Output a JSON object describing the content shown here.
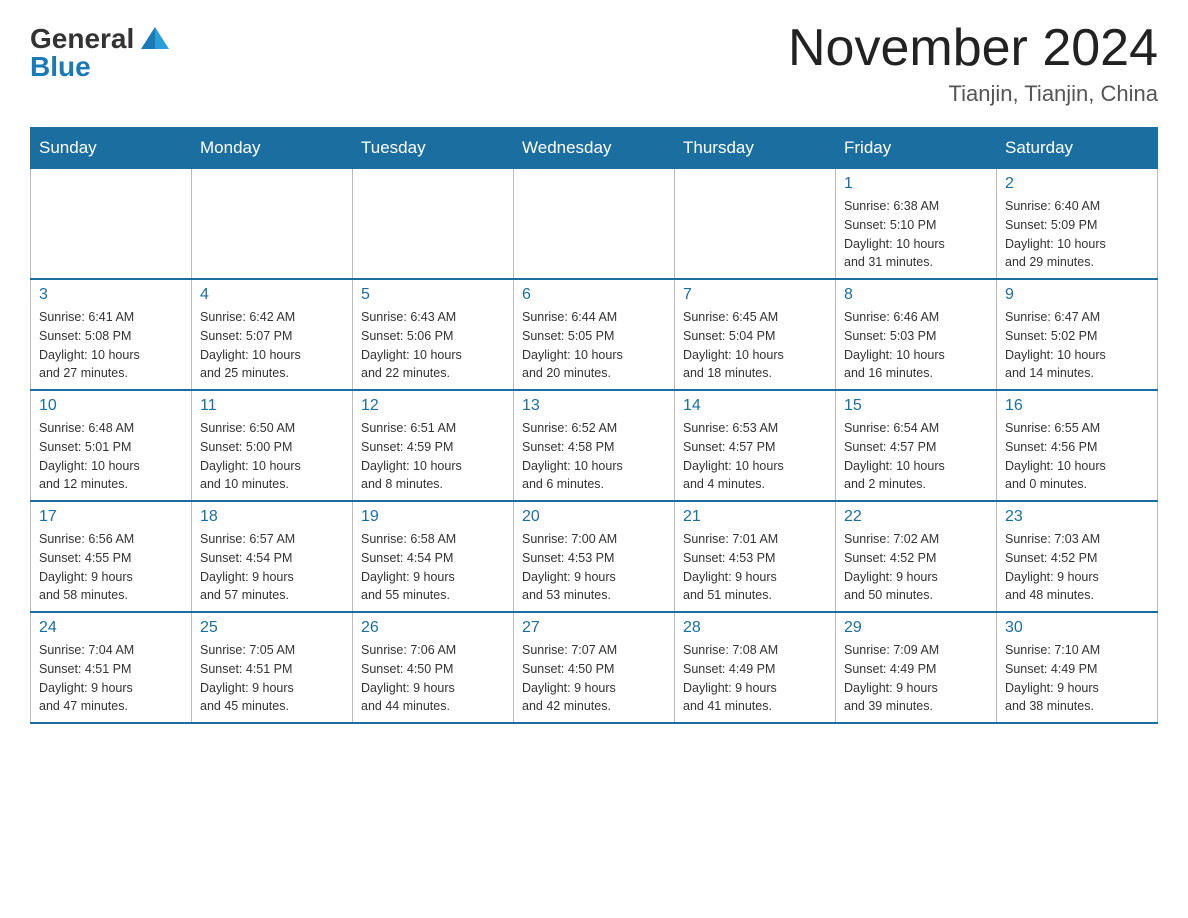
{
  "logo": {
    "general": "General",
    "blue": "Blue"
  },
  "title": {
    "month": "November 2024",
    "location": "Tianjin, Tianjin, China"
  },
  "days_of_week": [
    "Sunday",
    "Monday",
    "Tuesday",
    "Wednesday",
    "Thursday",
    "Friday",
    "Saturday"
  ],
  "weeks": [
    [
      {
        "day": "",
        "info": ""
      },
      {
        "day": "",
        "info": ""
      },
      {
        "day": "",
        "info": ""
      },
      {
        "day": "",
        "info": ""
      },
      {
        "day": "",
        "info": ""
      },
      {
        "day": "1",
        "info": "Sunrise: 6:38 AM\nSunset: 5:10 PM\nDaylight: 10 hours\nand 31 minutes."
      },
      {
        "day": "2",
        "info": "Sunrise: 6:40 AM\nSunset: 5:09 PM\nDaylight: 10 hours\nand 29 minutes."
      }
    ],
    [
      {
        "day": "3",
        "info": "Sunrise: 6:41 AM\nSunset: 5:08 PM\nDaylight: 10 hours\nand 27 minutes."
      },
      {
        "day": "4",
        "info": "Sunrise: 6:42 AM\nSunset: 5:07 PM\nDaylight: 10 hours\nand 25 minutes."
      },
      {
        "day": "5",
        "info": "Sunrise: 6:43 AM\nSunset: 5:06 PM\nDaylight: 10 hours\nand 22 minutes."
      },
      {
        "day": "6",
        "info": "Sunrise: 6:44 AM\nSunset: 5:05 PM\nDaylight: 10 hours\nand 20 minutes."
      },
      {
        "day": "7",
        "info": "Sunrise: 6:45 AM\nSunset: 5:04 PM\nDaylight: 10 hours\nand 18 minutes."
      },
      {
        "day": "8",
        "info": "Sunrise: 6:46 AM\nSunset: 5:03 PM\nDaylight: 10 hours\nand 16 minutes."
      },
      {
        "day": "9",
        "info": "Sunrise: 6:47 AM\nSunset: 5:02 PM\nDaylight: 10 hours\nand 14 minutes."
      }
    ],
    [
      {
        "day": "10",
        "info": "Sunrise: 6:48 AM\nSunset: 5:01 PM\nDaylight: 10 hours\nand 12 minutes."
      },
      {
        "day": "11",
        "info": "Sunrise: 6:50 AM\nSunset: 5:00 PM\nDaylight: 10 hours\nand 10 minutes."
      },
      {
        "day": "12",
        "info": "Sunrise: 6:51 AM\nSunset: 4:59 PM\nDaylight: 10 hours\nand 8 minutes."
      },
      {
        "day": "13",
        "info": "Sunrise: 6:52 AM\nSunset: 4:58 PM\nDaylight: 10 hours\nand 6 minutes."
      },
      {
        "day": "14",
        "info": "Sunrise: 6:53 AM\nSunset: 4:57 PM\nDaylight: 10 hours\nand 4 minutes."
      },
      {
        "day": "15",
        "info": "Sunrise: 6:54 AM\nSunset: 4:57 PM\nDaylight: 10 hours\nand 2 minutes."
      },
      {
        "day": "16",
        "info": "Sunrise: 6:55 AM\nSunset: 4:56 PM\nDaylight: 10 hours\nand 0 minutes."
      }
    ],
    [
      {
        "day": "17",
        "info": "Sunrise: 6:56 AM\nSunset: 4:55 PM\nDaylight: 9 hours\nand 58 minutes."
      },
      {
        "day": "18",
        "info": "Sunrise: 6:57 AM\nSunset: 4:54 PM\nDaylight: 9 hours\nand 57 minutes."
      },
      {
        "day": "19",
        "info": "Sunrise: 6:58 AM\nSunset: 4:54 PM\nDaylight: 9 hours\nand 55 minutes."
      },
      {
        "day": "20",
        "info": "Sunrise: 7:00 AM\nSunset: 4:53 PM\nDaylight: 9 hours\nand 53 minutes."
      },
      {
        "day": "21",
        "info": "Sunrise: 7:01 AM\nSunset: 4:53 PM\nDaylight: 9 hours\nand 51 minutes."
      },
      {
        "day": "22",
        "info": "Sunrise: 7:02 AM\nSunset: 4:52 PM\nDaylight: 9 hours\nand 50 minutes."
      },
      {
        "day": "23",
        "info": "Sunrise: 7:03 AM\nSunset: 4:52 PM\nDaylight: 9 hours\nand 48 minutes."
      }
    ],
    [
      {
        "day": "24",
        "info": "Sunrise: 7:04 AM\nSunset: 4:51 PM\nDaylight: 9 hours\nand 47 minutes."
      },
      {
        "day": "25",
        "info": "Sunrise: 7:05 AM\nSunset: 4:51 PM\nDaylight: 9 hours\nand 45 minutes."
      },
      {
        "day": "26",
        "info": "Sunrise: 7:06 AM\nSunset: 4:50 PM\nDaylight: 9 hours\nand 44 minutes."
      },
      {
        "day": "27",
        "info": "Sunrise: 7:07 AM\nSunset: 4:50 PM\nDaylight: 9 hours\nand 42 minutes."
      },
      {
        "day": "28",
        "info": "Sunrise: 7:08 AM\nSunset: 4:49 PM\nDaylight: 9 hours\nand 41 minutes."
      },
      {
        "day": "29",
        "info": "Sunrise: 7:09 AM\nSunset: 4:49 PM\nDaylight: 9 hours\nand 39 minutes."
      },
      {
        "day": "30",
        "info": "Sunrise: 7:10 AM\nSunset: 4:49 PM\nDaylight: 9 hours\nand 38 minutes."
      }
    ]
  ]
}
